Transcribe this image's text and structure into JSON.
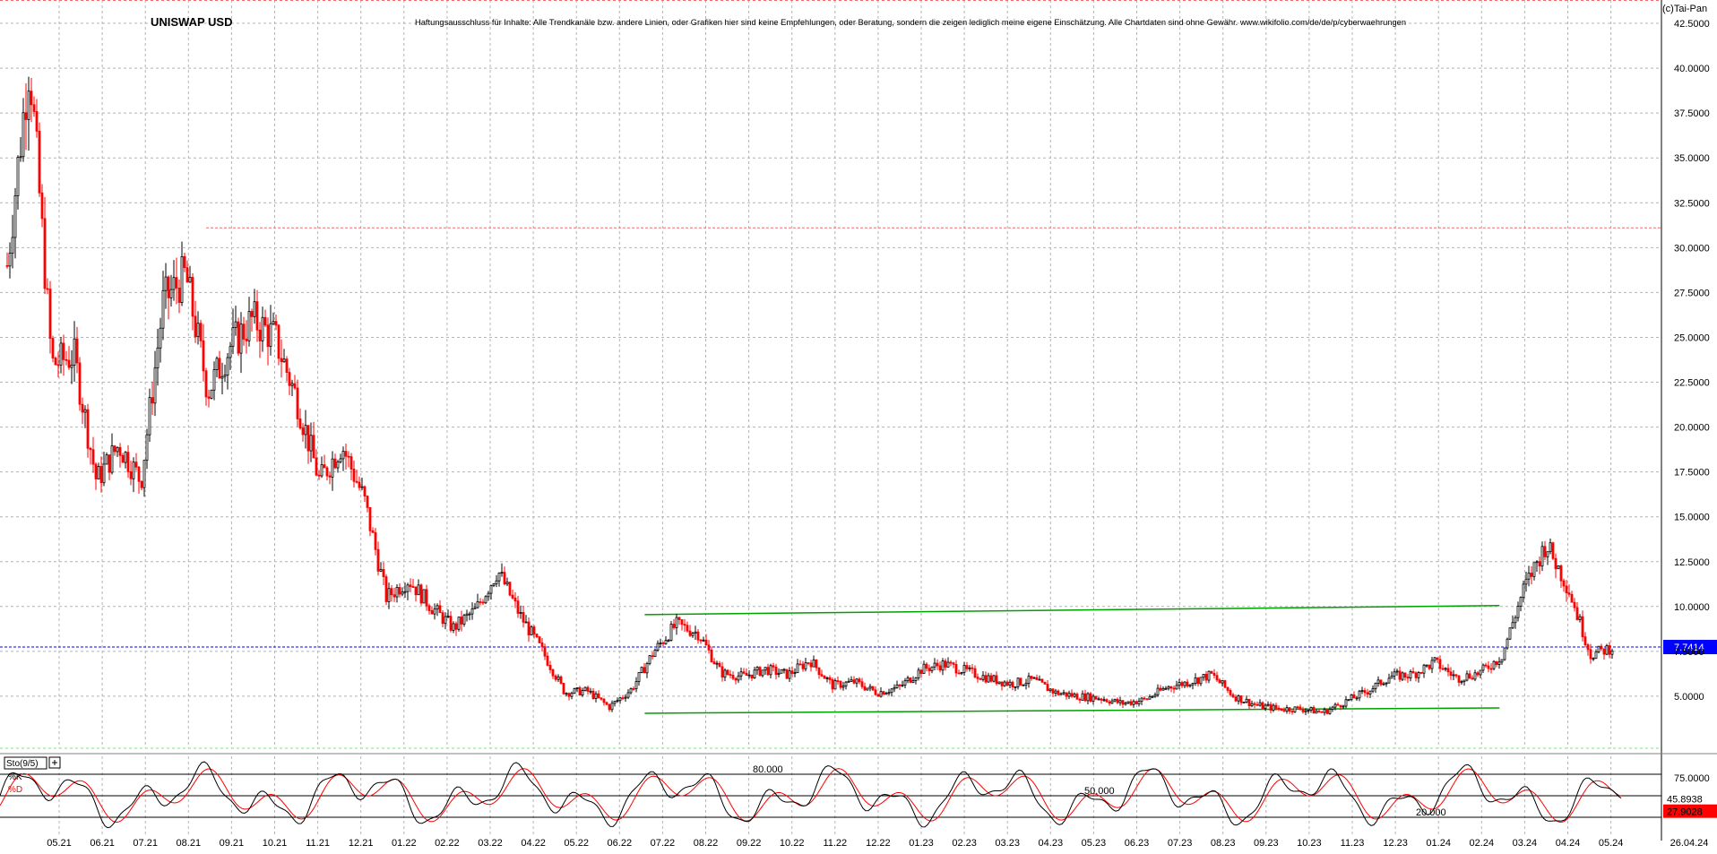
{
  "chart_data": {
    "type": "candlestick",
    "title": "UNISWAP USD",
    "disclaimer": "Haftungsausschluss für Inhalte: Alle Trendkanäle bzw. andere Linien, oder Grafiken hier sind keine Empfehlungen, oder Beratung, sondern die zeigen lediglich meine eigene Einschätzung. Alle Chartdaten sind ohne Gewähr. www.wikifolio.com/de/de/p/cyberwaehrungen",
    "copyright": "(c)Tai-Pan",
    "x_tick_labels": [
      "05.21",
      "06.21",
      "07.21",
      "08.21",
      "09.21",
      "10.21",
      "11.21",
      "12.21",
      "01.22",
      "02.22",
      "03.22",
      "04.22",
      "05.22",
      "06.22",
      "07.22",
      "08.22",
      "09.22",
      "10.22",
      "11.22",
      "12.22",
      "01.23",
      "02.23",
      "03.23",
      "04.23",
      "05.23",
      "06.23",
      "07.23",
      "08.23",
      "09.23",
      "10.23",
      "11.23",
      "12.23",
      "01.24",
      "02.24",
      "03.24",
      "04.24",
      "05.24"
    ],
    "x_end_label": "26.04.24",
    "y_tick_labels": [
      "42.5000",
      "40.0000",
      "37.5000",
      "35.0000",
      "32.5000",
      "30.0000",
      "27.5000",
      "25.0000",
      "22.5000",
      "20.0000",
      "17.5000",
      "15.0000",
      "12.5000",
      "10.0000",
      "7.5000",
      "5.0000"
    ],
    "y_ticks": [
      42.5,
      40,
      37.5,
      35,
      32.5,
      30,
      27.5,
      25,
      22.5,
      20,
      17.5,
      15,
      12.5,
      10,
      7.5,
      5
    ],
    "ylim": [
      2.1,
      43.8
    ],
    "current_price": 7.7414,
    "current_price_label": "7.7414",
    "bullish_color": "#000000",
    "bearish_color": "#ff0000",
    "price_line_color": "#0000ff",
    "trendline_color": "#00a000",
    "close_series": [
      {
        "month": "05.21",
        "value": 29.0
      },
      {
        "month": "05.21",
        "value": 40.5
      },
      {
        "month": "06.21",
        "value": 23.5
      },
      {
        "month": "06.21",
        "value": 24.0
      },
      {
        "month": "07.21",
        "value": 17.0
      },
      {
        "month": "07.21",
        "value": 19.0
      },
      {
        "month": "08.21",
        "value": 17.0
      },
      {
        "month": "08.21",
        "value": 27.0
      },
      {
        "month": "09.21",
        "value": 28.5
      },
      {
        "month": "09.21",
        "value": 22.0
      },
      {
        "month": "10.21",
        "value": 24.5
      },
      {
        "month": "10.21",
        "value": 26.0
      },
      {
        "month": "11.21",
        "value": 25.0
      },
      {
        "month": "11.21",
        "value": 21.5
      },
      {
        "month": "12.21",
        "value": 17.0
      },
      {
        "month": "12.21",
        "value": 19.0
      },
      {
        "month": "01.22",
        "value": 16.0
      },
      {
        "month": "01.22",
        "value": 10.5
      },
      {
        "month": "02.22",
        "value": 11.5
      },
      {
        "month": "02.22",
        "value": 10.0
      },
      {
        "month": "03.22",
        "value": 8.8
      },
      {
        "month": "03.22",
        "value": 9.8
      },
      {
        "month": "04.22",
        "value": 12.0
      },
      {
        "month": "04.22",
        "value": 9.5
      },
      {
        "month": "05.22",
        "value": 7.5
      },
      {
        "month": "05.22",
        "value": 5.2
      },
      {
        "month": "06.22",
        "value": 5.3
      },
      {
        "month": "06.22",
        "value": 4.4
      },
      {
        "month": "07.22",
        "value": 5.4
      },
      {
        "month": "07.22",
        "value": 7.5
      },
      {
        "month": "08.22",
        "value": 9.0
      },
      {
        "month": "08.22",
        "value": 8.5
      },
      {
        "month": "09.22",
        "value": 6.3
      },
      {
        "month": "09.22",
        "value": 6.1
      },
      {
        "month": "10.22",
        "value": 6.5
      },
      {
        "month": "10.22",
        "value": 6.2
      },
      {
        "month": "11.22",
        "value": 7.0
      },
      {
        "month": "11.22",
        "value": 5.6
      },
      {
        "month": "12.22",
        "value": 5.8
      },
      {
        "month": "12.22",
        "value": 5.2
      },
      {
        "month": "01.23",
        "value": 5.5
      },
      {
        "month": "01.23",
        "value": 6.5
      },
      {
        "month": "02.23",
        "value": 6.8
      },
      {
        "month": "02.23",
        "value": 6.4
      },
      {
        "month": "03.23",
        "value": 6.0
      },
      {
        "month": "03.23",
        "value": 5.7
      },
      {
        "month": "04.23",
        "value": 5.9
      },
      {
        "month": "04.23",
        "value": 5.2
      },
      {
        "month": "05.23",
        "value": 5.0
      },
      {
        "month": "05.23",
        "value": 4.9
      },
      {
        "month": "06.23",
        "value": 4.6
      },
      {
        "month": "06.23",
        "value": 4.8
      },
      {
        "month": "07.23",
        "value": 5.5
      },
      {
        "month": "07.23",
        "value": 5.8
      },
      {
        "month": "08.23",
        "value": 6.2
      },
      {
        "month": "08.23",
        "value": 5.0
      },
      {
        "month": "09.23",
        "value": 4.5
      },
      {
        "month": "09.23",
        "value": 4.3
      },
      {
        "month": "10.23",
        "value": 4.3
      },
      {
        "month": "10.23",
        "value": 4.1
      },
      {
        "month": "11.23",
        "value": 4.7
      },
      {
        "month": "11.23",
        "value": 5.3
      },
      {
        "month": "12.23",
        "value": 6.1
      },
      {
        "month": "12.23",
        "value": 6.2
      },
      {
        "month": "01.24",
        "value": 6.9
      },
      {
        "month": "01.24",
        "value": 6.0
      },
      {
        "month": "02.24",
        "value": 6.3
      },
      {
        "month": "02.24",
        "value": 7.2
      },
      {
        "month": "03.24",
        "value": 11.0
      },
      {
        "month": "03.24",
        "value": 13.5
      },
      {
        "month": "04.24",
        "value": 11.0
      },
      {
        "month": "04.24",
        "value": 7.3
      },
      {
        "month": "05.24",
        "value": 7.74
      }
    ],
    "resistance_lines": [
      {
        "value": 31.1,
        "color": "#e87070"
      }
    ],
    "trendlines": [
      {
        "start_month": "07.22",
        "start_value": 9.55,
        "end_month": "02.24",
        "end_value": 10.05
      },
      {
        "start_month": "07.22",
        "start_value": 4.05,
        "end_month": "02.24",
        "end_value": 4.35
      }
    ],
    "stochastic": {
      "label": "Sto(9/5)",
      "k_label": "%K",
      "d_label": "%D",
      "k_color": "#000000",
      "d_color": "#ff0000",
      "levels": [
        80,
        50,
        20
      ],
      "level_labels": [
        "80.000",
        "50.000",
        "20.000"
      ],
      "k_value": 45.8938,
      "d_value": 27.9028,
      "k_value_label": "45.8938",
      "d_value_label": "27.9028",
      "y_tick_labels": [
        "75.0000",
        "25.0000"
      ],
      "y_ticks": [
        75,
        25
      ]
    }
  }
}
